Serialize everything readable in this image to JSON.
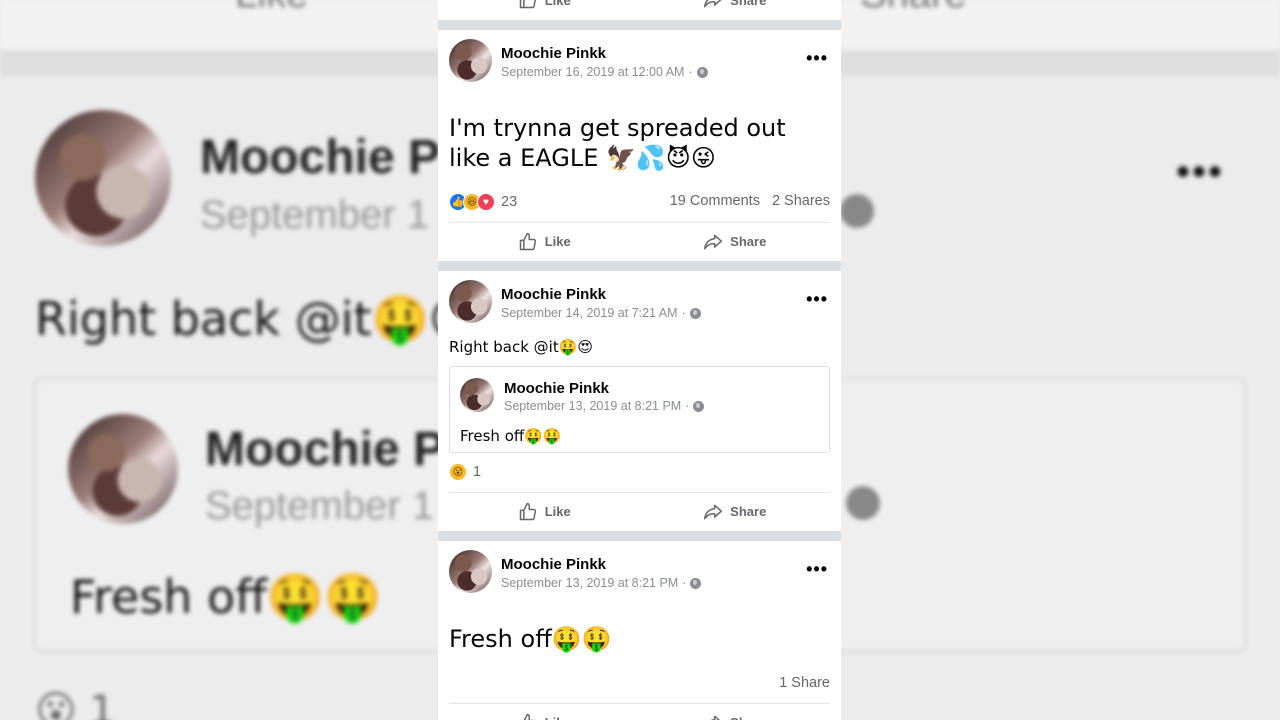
{
  "author": "Moochie Pinkk",
  "actions": {
    "like": "Like",
    "share": "Share"
  },
  "more": "•••",
  "posts": [
    {
      "date": "September 16, 2019 at 12:00 AM",
      "sep": "·",
      "text": "I'm trynna get spreaded out like a EAGLE 🦅💦😈😜",
      "reaction_count": "23",
      "comments": "19 Comments",
      "shares": "2 Shares"
    },
    {
      "date": "September 14, 2019 at 7:21 AM",
      "sep": "·",
      "text": "Right back @it🤑😍",
      "shared": {
        "author": "Moochie Pinkk",
        "date": "September 13, 2019 at 8:21 PM",
        "sep": "·",
        "text": "Fresh off🤑🤑"
      },
      "reaction_count": "1"
    },
    {
      "date": "September 13, 2019 at 8:21 PM",
      "sep": "·",
      "text": "Fresh off🤑🤑",
      "shares": "1 Share"
    }
  ],
  "background": {
    "name_fragment": "Moochie P",
    "date_fragment": "September 1",
    "text1": "Right back @it🤑😍",
    "text2": "Fresh off🤑🤑",
    "react_fragment": "😮 1",
    "like_fragment": "Like",
    "share_fragment": "Share",
    "dots": "•••"
  },
  "icons": {
    "like": "thumbs-up-icon",
    "share": "share-arrow-icon",
    "more": "more-dots-icon",
    "globe": "globe-icon",
    "reaction_like": "like-reaction-icon",
    "reaction_haha": "haha-reaction-icon",
    "reaction_love": "love-reaction-icon",
    "reaction_wow": "wow-reaction-icon"
  },
  "colors": {
    "facebook_blue": "#1877f2",
    "love_red": "#f33e58",
    "reaction_yellow": "#f7b928",
    "secondary_text": "#65676b",
    "feed_separator": "#dadde1"
  }
}
